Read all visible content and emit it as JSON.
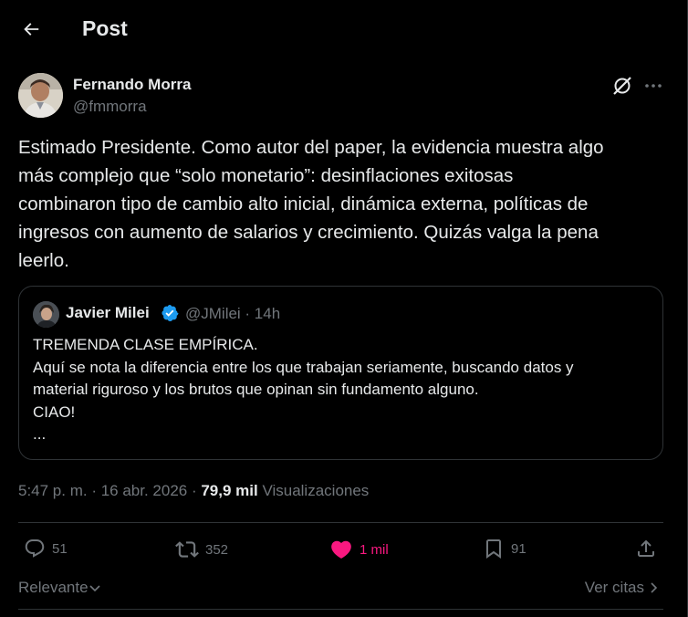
{
  "header": {
    "title": "Post"
  },
  "author": {
    "name": "Fernando Morra",
    "handle": "@fmmorra"
  },
  "post": {
    "lines": [
      "Estimado Presidente. Como autor del paper, la evidencia muestra algo",
      "más complejo que “solo monetario”: desinflaciones exitosas",
      "combinaron tipo de cambio alto inicial, dinámica externa, políticas de",
      "ingresos con aumento de salarios y crecimiento. Quizás valga la pena",
      "leerlo."
    ]
  },
  "quote": {
    "name": "Javier Milei",
    "meta": "@JMilei · 14h",
    "lines": [
      "TREMENDA CLASE EMPÍRICA.",
      "Aquí se nota la diferencia entre los que trabajan seriamente, buscando datos y",
      "material riguroso y los brutos que opinan sin fundamento alguno.",
      "CIAO!",
      "..."
    ]
  },
  "timestamp": {
    "time_date": "5:47 p. m. · 16 abr. 2026 · ",
    "views_count": "79,9 mil",
    "views_label": " Visualizaciones"
  },
  "actions": {
    "replies": "51",
    "reposts": "352",
    "likes": "1 mil",
    "bookmarks": "91"
  },
  "bottom": {
    "sort_label": "Relevante",
    "quotes_label": "Ver citas"
  },
  "colors": {
    "background": "#000000",
    "text": "#e7e9ea",
    "muted": "#71767b",
    "like": "#f91880",
    "verified": "#1d9bf0",
    "border": "#2f3336"
  },
  "icons": [
    "back-arrow-icon",
    "grok-icon",
    "more-icon",
    "verified-badge-icon",
    "reply-icon",
    "repost-icon",
    "heart-icon",
    "bookmark-icon",
    "share-icon",
    "chevron-down-icon",
    "chevron-right-icon"
  ]
}
